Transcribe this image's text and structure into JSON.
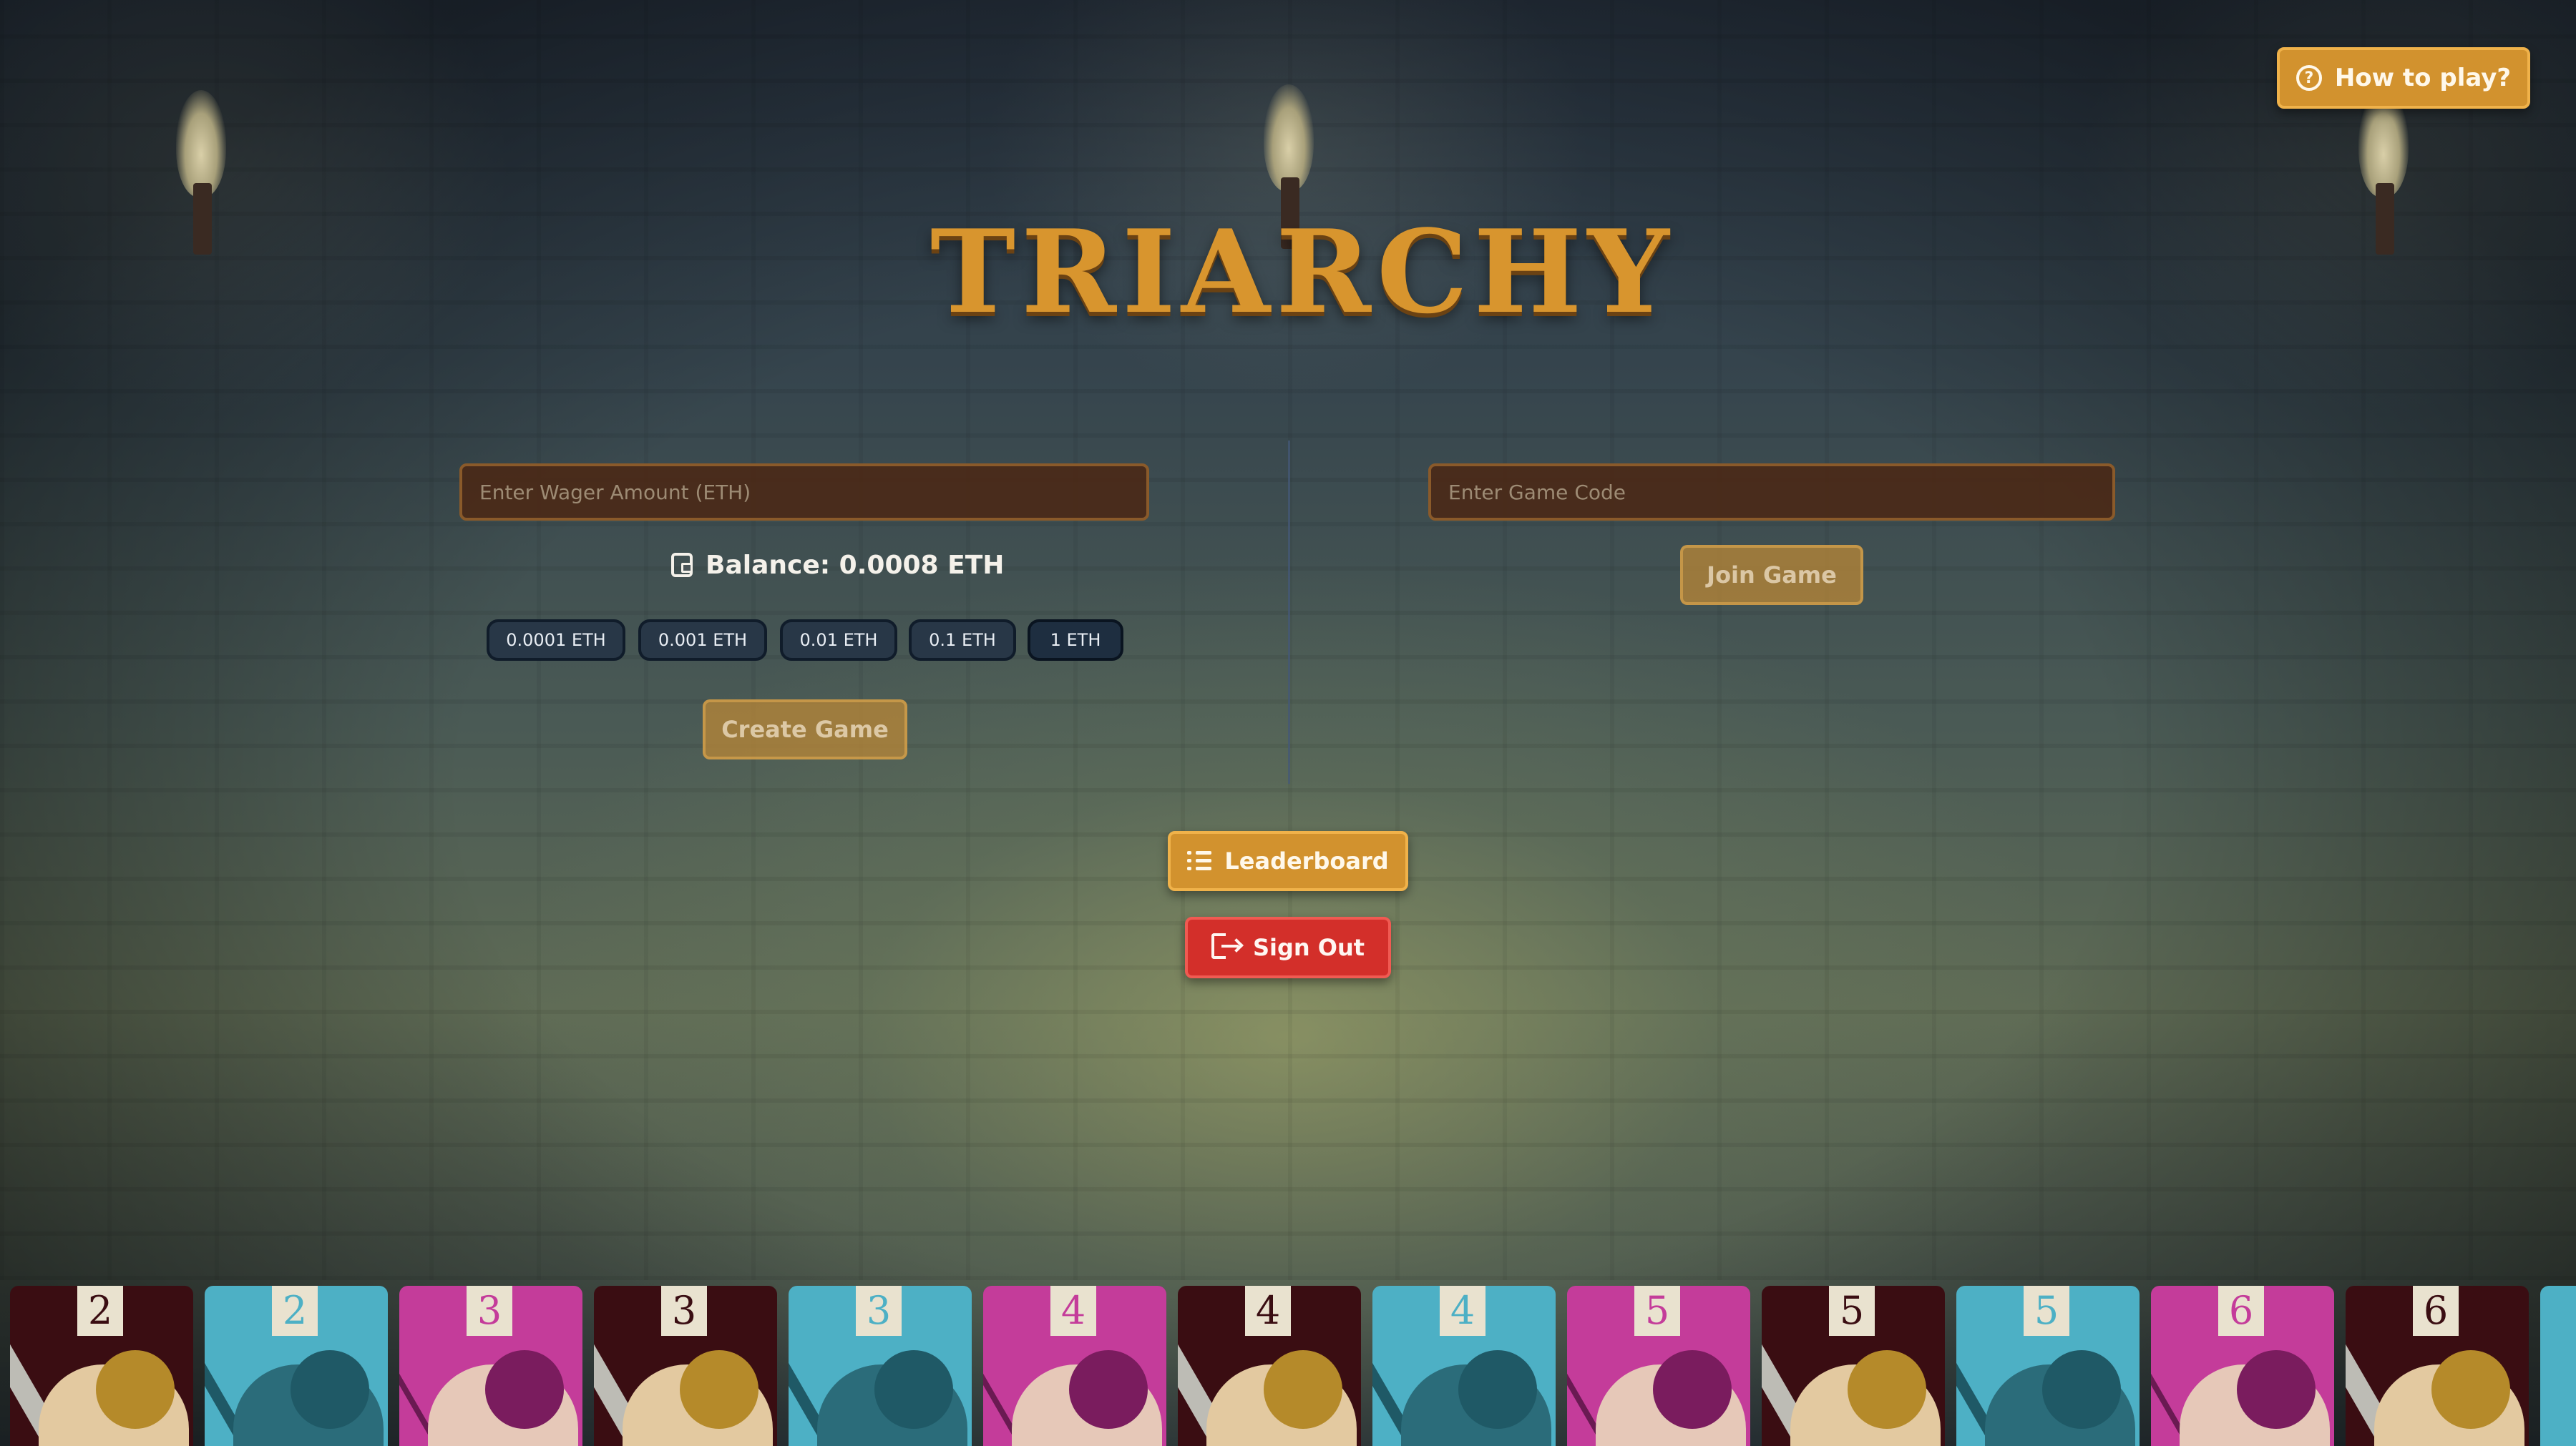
{
  "app": {
    "title": "TRIARCHY",
    "help_label": "How to play?"
  },
  "create": {
    "wager_placeholder": "Enter Wager Amount (ETH)",
    "balance_label": "Balance: 0.0008 ETH",
    "presets": [
      "0.0001 ETH",
      "0.001 ETH",
      "0.01 ETH",
      "0.1 ETH",
      "1 ETH"
    ],
    "create_label": "Create Game"
  },
  "join": {
    "code_placeholder": "Enter Game Code",
    "join_label": "Join Game"
  },
  "actions": {
    "leaderboard_label": "Leaderboard",
    "signout_label": "Sign Out"
  },
  "cards": [
    {
      "value": "2",
      "color": "red"
    },
    {
      "value": "2",
      "color": "blue"
    },
    {
      "value": "3",
      "color": "pink"
    },
    {
      "value": "3",
      "color": "red"
    },
    {
      "value": "3",
      "color": "blue"
    },
    {
      "value": "4",
      "color": "pink"
    },
    {
      "value": "4",
      "color": "red"
    },
    {
      "value": "4",
      "color": "blue"
    },
    {
      "value": "5",
      "color": "pink"
    },
    {
      "value": "5",
      "color": "red"
    },
    {
      "value": "5",
      "color": "blue"
    },
    {
      "value": "6",
      "color": "pink"
    },
    {
      "value": "6",
      "color": "red"
    }
  ],
  "colors": {
    "accent": "#d2922e",
    "danger": "#d32f2a",
    "card_red": "#3a0d12",
    "card_blue": "#4db0c5",
    "card_pink": "#c43c9a"
  }
}
